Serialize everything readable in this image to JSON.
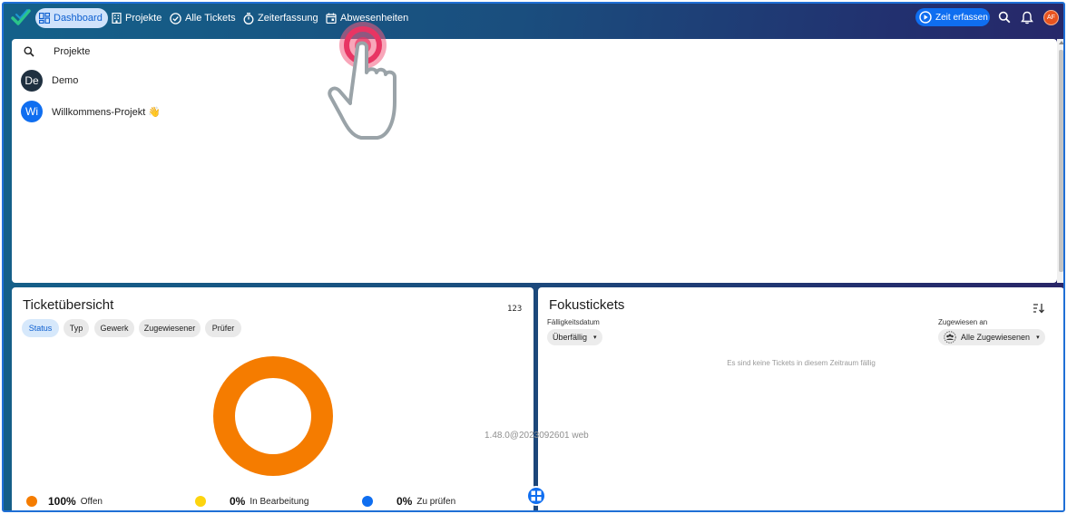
{
  "nav": {
    "items": [
      {
        "label": "Dashboard",
        "icon": "dashboard-icon",
        "active": true
      },
      {
        "label": "Projekte",
        "icon": "building-icon",
        "active": false
      },
      {
        "label": "Alle Tickets",
        "icon": "check-circle-icon",
        "active": false
      },
      {
        "label": "Zeiterfassung",
        "icon": "stopwatch-icon",
        "active": false
      },
      {
        "label": "Abwesenheiten",
        "icon": "calendar-icon",
        "active": false
      }
    ],
    "timer_label": "Zeit erfassen",
    "user_initials": "AF"
  },
  "project_panel": {
    "search_placeholder": "Projekte",
    "projects": [
      {
        "initials": "De",
        "name": "Demo",
        "color": "#1f3040"
      },
      {
        "initials": "Wi",
        "name": "Willkommens-Projekt 👋",
        "color": "#0f6ef0"
      }
    ]
  },
  "ticket_overview": {
    "title": "Ticketübersicht",
    "count_toggle": "123",
    "filters": [
      {
        "label": "Status",
        "active": true
      },
      {
        "label": "Typ",
        "active": false
      },
      {
        "label": "Gewerk",
        "active": false
      },
      {
        "label": "Zugewiesener",
        "active": false
      },
      {
        "label": "Prüfer",
        "active": false
      }
    ],
    "legend": [
      {
        "percent": "100%",
        "label": "Offen",
        "color": "#f57c00"
      },
      {
        "percent": "0%",
        "label": "In Bearbeitung",
        "color": "#fdd40e"
      },
      {
        "percent": "0%",
        "label": "Zu prüfen",
        "color": "#0f6ef0"
      }
    ]
  },
  "chart_data": {
    "type": "pie",
    "categories": [
      "Offen",
      "In Bearbeitung",
      "Zu prüfen"
    ],
    "values": [
      100,
      0,
      0
    ],
    "colors": [
      "#f57c00",
      "#fdd40e",
      "#0f6ef0"
    ],
    "title": "",
    "xlabel": "",
    "ylabel": ""
  },
  "focus_tickets": {
    "title": "Fokustickets",
    "due_label": "Fälligkeitsdatum",
    "due_value": "Überfällig",
    "assigned_label": "Zugewiesen an",
    "assigned_value": "Alle Zugewiesenen",
    "empty_message": "Es sind keine Tickets in diesem Zeitraum fällig"
  },
  "version": "1.48.0@2023092601 web",
  "colors": {
    "accent": "#0f6ef0",
    "header_start": "#14618a",
    "header_end": "#2a2466"
  }
}
